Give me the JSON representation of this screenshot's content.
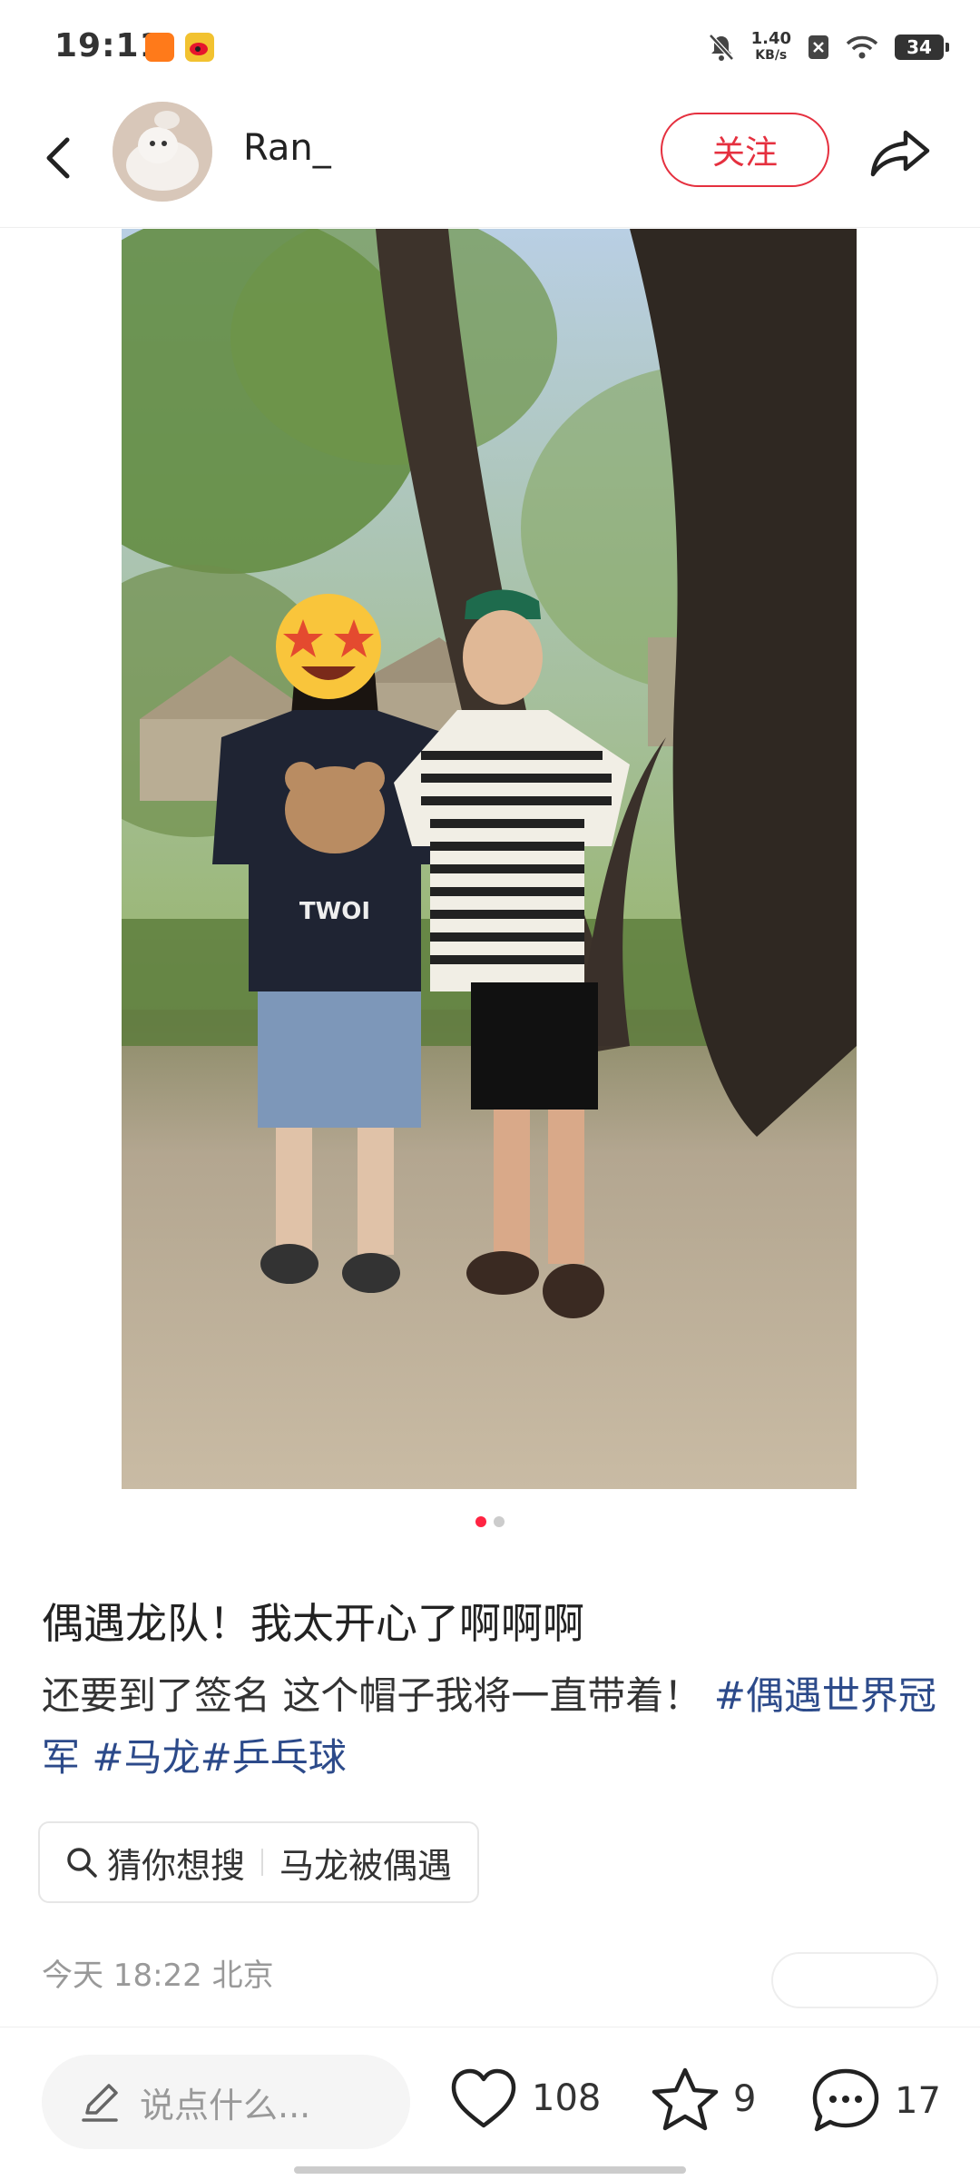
{
  "status_bar": {
    "time": "19:11",
    "net_speed_value": "1.40",
    "net_speed_unit": "KB/s",
    "battery": "34"
  },
  "header": {
    "username": "Ran_",
    "follow_label": "关注"
  },
  "post": {
    "image_count": 2,
    "active_image_index": 0,
    "shirt_text": "TWOI",
    "title": "偶遇龙队！我太开心了啊啊啊",
    "desc_text": "还要到了签名 这个帽子我将一直带着！",
    "hashtags": [
      "#偶遇世界冠军",
      "#马龙",
      "#乒乓球"
    ],
    "search_prefix": "猜你想搜",
    "search_term": "马龙被偶遇",
    "meta": "今天 18:22 北京"
  },
  "bottom_bar": {
    "comment_placeholder": "说点什么...",
    "likes": "108",
    "favorites": "9",
    "comments": "17"
  },
  "colors": {
    "accent_red": "#e5303f",
    "hashtag_blue": "#2c4a8a"
  },
  "icons": [
    "back-icon",
    "share-icon",
    "search-icon",
    "pen-icon",
    "heart-icon",
    "star-icon",
    "comment-icon",
    "mute-icon",
    "wifi-icon"
  ]
}
